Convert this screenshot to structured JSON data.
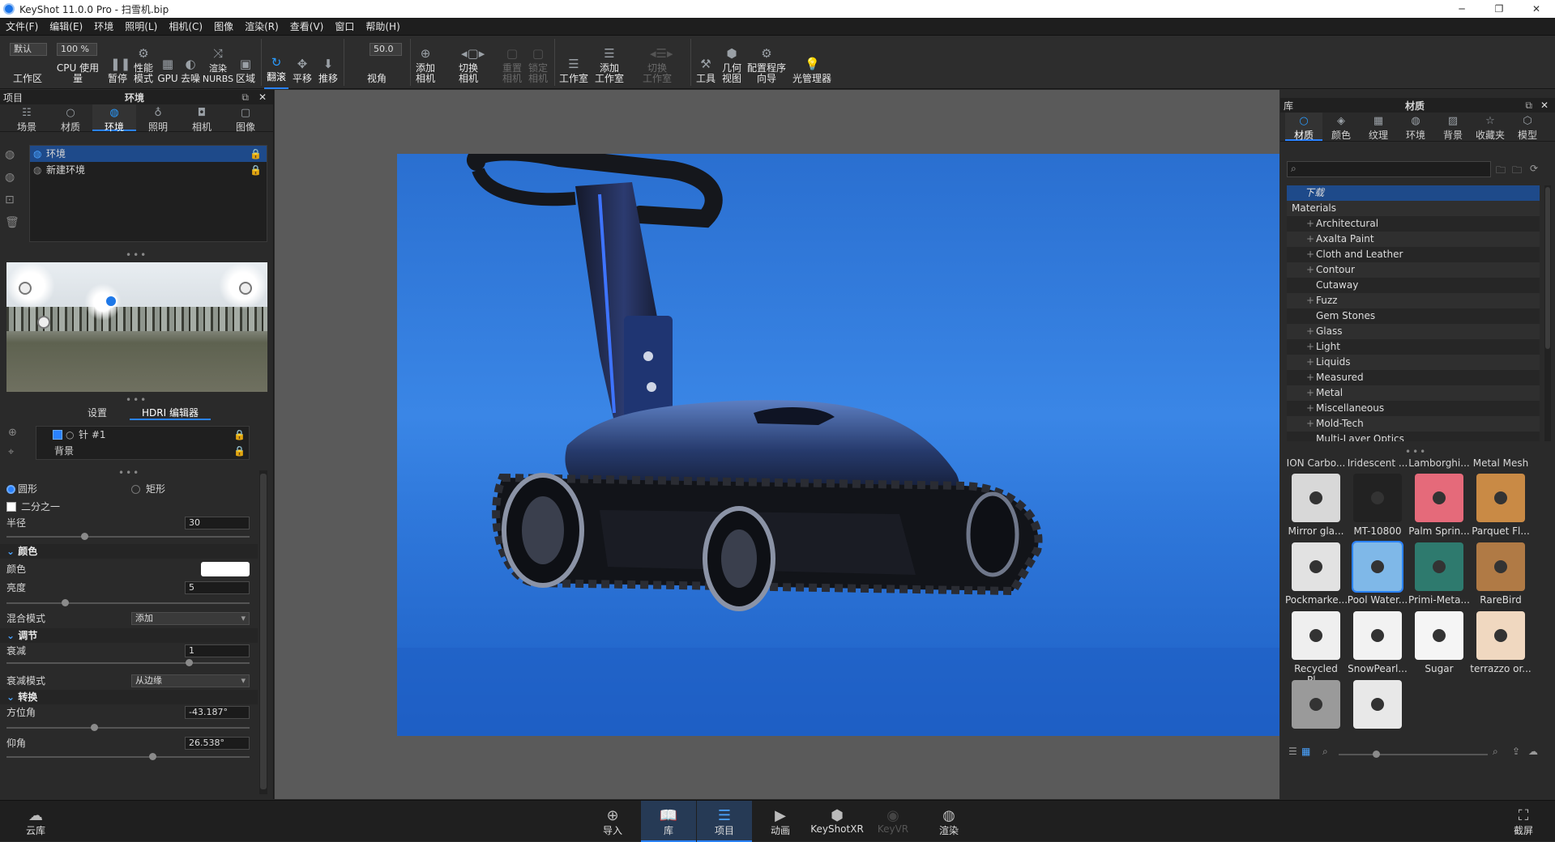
{
  "window": {
    "title": "KeyShot 11.0.0 Pro  - 扫雪机.bip",
    "minimize": "─",
    "maximize": "❐",
    "close": "✕"
  },
  "menu": [
    "文件(F)",
    "编辑(E)",
    "环境",
    "照明(L)",
    "相机(C)",
    "图像",
    "渲染(R)",
    "查看(V)",
    "窗口",
    "帮助(H)"
  ],
  "toolbar": {
    "workspace_select": "默认",
    "cpu_percent": "100 %",
    "fov_value": "50.0",
    "buttons": [
      {
        "label": "工作区",
        "icon": "workspace-icon"
      },
      {
        "label": "CPU 使用量",
        "icon": "cpu-icon"
      },
      {
        "label": "暂停",
        "icon": "pause-icon"
      },
      {
        "label": "性能\n模式",
        "icon": "performance-icon"
      },
      {
        "label": "GPU",
        "icon": "gpu-icon"
      },
      {
        "label": "去噪",
        "icon": "denoise-icon"
      },
      {
        "label": "渲染\nNURBS",
        "icon": "nurbs-icon"
      },
      {
        "label": "区域",
        "icon": "region-icon"
      },
      {
        "label": "翻滚",
        "icon": "tumble-icon"
      },
      {
        "label": "平移",
        "icon": "pan-icon"
      },
      {
        "label": "推移",
        "icon": "dolly-icon"
      },
      {
        "label": "视角",
        "icon": "fov-icon"
      },
      {
        "label": "添加\n相机",
        "icon": "add-camera-icon"
      },
      {
        "label": "切换\n相机",
        "icon": "switch-camera-icon"
      },
      {
        "label": "重置\n相机",
        "icon": "reset-camera-icon"
      },
      {
        "label": "锁定\n相机",
        "icon": "lock-camera-icon"
      },
      {
        "label": "工作室",
        "icon": "studio-icon"
      },
      {
        "label": "添加\n工作室",
        "icon": "add-studio-icon"
      },
      {
        "label": "切换\n工作室",
        "icon": "switch-studio-icon"
      },
      {
        "label": "工具",
        "icon": "tools-icon"
      },
      {
        "label": "几何\n视图",
        "icon": "geometry-view-icon"
      },
      {
        "label": "配置程序\n向导",
        "icon": "configurator-icon"
      },
      {
        "label": "光管理器",
        "icon": "light-manager-icon"
      }
    ]
  },
  "left_panel": {
    "header_left": "项目",
    "header_title": "环境",
    "tabs": [
      {
        "label": "场景",
        "icon": "scene-icon"
      },
      {
        "label": "材质",
        "icon": "material-icon"
      },
      {
        "label": "环境",
        "icon": "environment-icon"
      },
      {
        "label": "照明",
        "icon": "lighting-icon"
      },
      {
        "label": "相机",
        "icon": "camera-icon"
      },
      {
        "label": "图像",
        "icon": "image-icon"
      }
    ],
    "env_list": [
      "环境",
      "新建环境"
    ],
    "subtabs": [
      "设置",
      "HDRI 编辑器"
    ],
    "pin_list": [
      "针 #1",
      "背景"
    ],
    "shape_circle": "圆形",
    "shape_rect": "矩形",
    "half": "二分之一",
    "radius_label": "半径",
    "radius_value": "30",
    "radius_level": 0.32,
    "color_section": "颜色",
    "color_label": "颜色",
    "color_value": "#ffffff",
    "brightness_label": "亮度",
    "brightness_value": "5",
    "brightness_level": 0.24,
    "blend_label": "混合模式",
    "blend_value": "添加",
    "adjust_section": "调节",
    "falloff_label": "衰减",
    "falloff_value": "1",
    "falloff_level": 0.75,
    "falloff_mode_label": "衰减模式",
    "falloff_mode_value": "从边缘",
    "transform_section": "转换",
    "azimuth_label": "方位角",
    "azimuth_value": "-43.187°",
    "azimuth_level": 0.36,
    "elevation_label": "仰角",
    "elevation_value": "26.538°",
    "elevation_level": 0.6
  },
  "right_panel": {
    "header_left": "库",
    "header_title": "材质",
    "tabs": [
      {
        "label": "材质",
        "icon": "material-icon"
      },
      {
        "label": "颜色",
        "icon": "color-icon"
      },
      {
        "label": "纹理",
        "icon": "texture-icon"
      },
      {
        "label": "环境",
        "icon": "environment-icon"
      },
      {
        "label": "背景",
        "icon": "background-icon"
      },
      {
        "label": "收藏夹",
        "icon": "favorites-icon"
      },
      {
        "label": "模型",
        "icon": "model-icon"
      }
    ],
    "search_placeholder": "",
    "tree": [
      "下载",
      "Materials",
      "Architectural",
      "Axalta Paint",
      "Cloth and Leather",
      "Contour",
      "Cutaway",
      "Fuzz",
      "Gem Stones",
      "Glass",
      "Light",
      "Liquids",
      "Measured",
      "Metal",
      "Miscellaneous",
      "Mold-Tech",
      "Multi-Layer Optics"
    ],
    "top_row": [
      "ION Carbo...",
      "Iridescent ...",
      "Lamborghi...",
      "Metal Mesh"
    ],
    "thumbs": [
      {
        "label": "Mirror gla...",
        "color": "#d8d8d8"
      },
      {
        "label": "MT-10800",
        "color": "#222222"
      },
      {
        "label": "Palm Sprin...",
        "color": "#e56a7a"
      },
      {
        "label": "Parquet Fl...",
        "color": "#c98a45"
      },
      {
        "label": "Pockmarke...",
        "color": "#e2e2e2"
      },
      {
        "label": "Pool Water...",
        "color": "#7fb8e8"
      },
      {
        "label": "Primi-Meta...",
        "color": "#2e7a6e"
      },
      {
        "label": "RareBird",
        "color": "#b07a45"
      },
      {
        "label": "Recycled Pl...",
        "color": "#efefef"
      },
      {
        "label": "SnowPearl...",
        "color": "#f2f2f2"
      },
      {
        "label": "Sugar",
        "color": "#f5f5f5"
      },
      {
        "label": "terrazzo or...",
        "color": "#f0d8c0"
      },
      {
        "label": "",
        "color": "#9a9a9a"
      },
      {
        "label": "",
        "color": "#e8e8e8"
      }
    ]
  },
  "bottom_bar": [
    {
      "label": "云库",
      "icon": "cloud-library-icon"
    },
    {
      "label": "导入",
      "icon": "import-icon"
    },
    {
      "label": "库",
      "icon": "library-icon"
    },
    {
      "label": "项目",
      "icon": "project-icon"
    },
    {
      "label": "动画",
      "icon": "animation-icon"
    },
    {
      "label": "KeyShotXR",
      "icon": "keyshotxr-icon"
    },
    {
      "label": "KeyVR",
      "icon": "keyvr-icon"
    },
    {
      "label": "渲染",
      "icon": "render-icon"
    },
    {
      "label": "截屏",
      "icon": "screenshot-icon"
    }
  ]
}
